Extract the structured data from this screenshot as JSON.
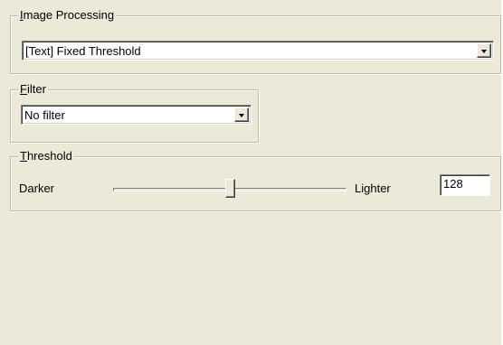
{
  "image_processing": {
    "legend_first": "I",
    "legend_rest": "mage Processing",
    "selected": "[Text] Fixed Threshold"
  },
  "filter": {
    "legend_first": "F",
    "legend_rest": "ilter",
    "selected": "No filter"
  },
  "threshold": {
    "legend_first": "T",
    "legend_rest": "hreshold",
    "left_label": "Darker",
    "right_label": "Lighter",
    "value": "128",
    "slider_fraction": 0.5
  }
}
